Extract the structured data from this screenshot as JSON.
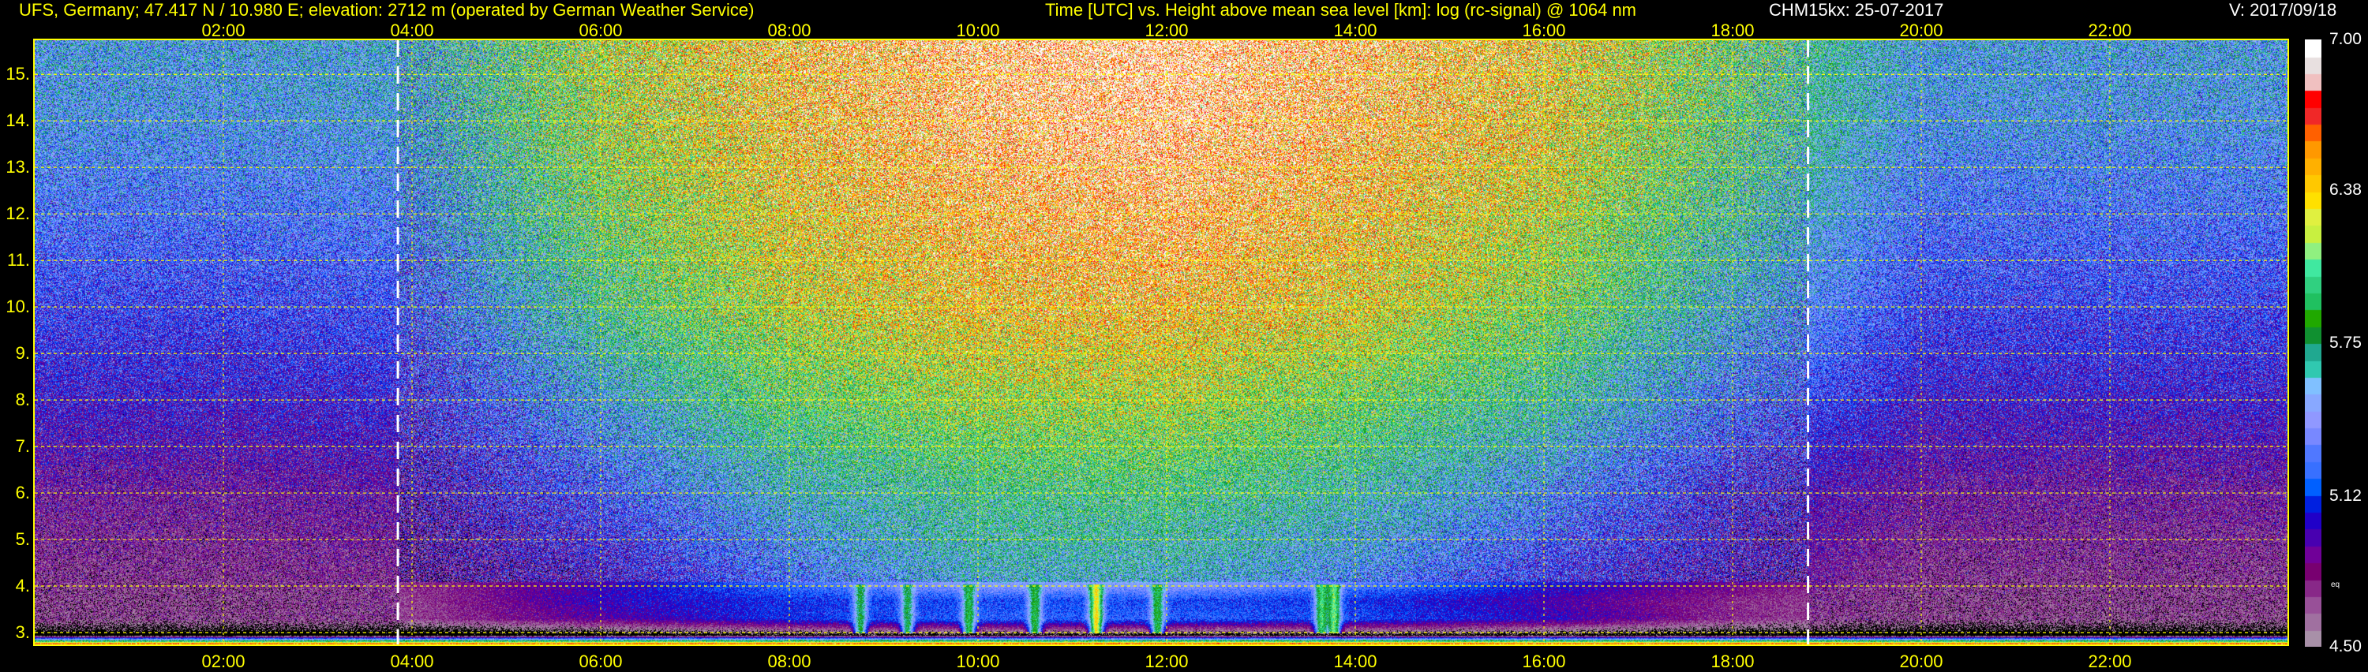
{
  "header": {
    "station": "UFS, Germany; 47.417 N / 10.980 E; elevation: 2712 m  (operated by German Weather Service)",
    "plot_title": "Time [UTC] vs. Height above mean sea level [km]: log (rc-signal) @ 1064 nm",
    "instrument": "CHM15kx: 25-07-2017",
    "version": "V: 2017/09/18"
  },
  "chart_data": {
    "type": "heatmap",
    "title": "Time [UTC] vs. Height above mean sea level [km]: log (rc-signal) @ 1064 nm",
    "xlabel": "Time [UTC]",
    "ylabel": "Height above mean sea level [km]",
    "xlim": [
      0,
      23.83
    ],
    "ylim": [
      2.712,
      15.75
    ],
    "x_ticks": [
      2,
      4,
      6,
      8,
      10,
      12,
      14,
      16,
      18,
      20,
      22
    ],
    "x_tick_labels": [
      "02:00",
      "04:00",
      "06:00",
      "08:00",
      "10:00",
      "12:00",
      "14:00",
      "16:00",
      "18:00",
      "20:00",
      "22:00"
    ],
    "y_ticks": [
      3,
      4,
      5,
      6,
      7,
      8,
      9,
      10,
      11,
      12,
      13,
      14,
      15
    ],
    "y_tick_labels": [
      "3.",
      "4.",
      "5.",
      "6.",
      "7.",
      "8.",
      "9.",
      "10.",
      "11.",
      "12.",
      "13.",
      "14.",
      "15."
    ],
    "grid": true,
    "dashed_markers_h": [
      3.85,
      18.8
    ],
    "colorbar": {
      "range": [
        4.5,
        7.0
      ],
      "tick_labels": [
        "7.00",
        "6.38",
        "5.75",
        "5.12",
        "4.50"
      ],
      "tick_values": [
        7.0,
        6.38,
        5.75,
        5.12,
        4.5
      ],
      "note": "eq",
      "colors_low_to_high": [
        "#a890a8",
        "#a070a0",
        "#985098",
        "#882888",
        "#780070",
        "#700098",
        "#4800b0",
        "#2000c8",
        "#0020e0",
        "#0060ff",
        "#3870ff",
        "#5078ff",
        "#7888ff",
        "#9098ff",
        "#88a8ff",
        "#80c0ff",
        "#30c8b0",
        "#20a890",
        "#109030",
        "#20a800",
        "#20c060",
        "#30d080",
        "#40e8a0",
        "#90f080",
        "#c8f040",
        "#e0f040",
        "#ffe000",
        "#ffc800",
        "#ffb000",
        "#ff9800",
        "#ff6000",
        "#f02828",
        "#ff0000",
        "#f0c0c0",
        "#e8e0e0",
        "#ffffff"
      ]
    },
    "grid_times_h": [
      0,
      2,
      4,
      6,
      8,
      10,
      12,
      14,
      16,
      18,
      20,
      22,
      24
    ],
    "grid_heights_km": [
      2.75,
      2.95,
      3.3,
      3.7,
      4.2,
      6,
      8,
      10,
      12,
      14,
      15.75
    ],
    "mean_log_signal": [
      [
        6.85,
        6.85,
        6.85,
        6.85,
        6.85,
        6.85,
        6.85,
        6.85,
        6.85,
        6.85,
        6.85,
        6.85,
        6.85
      ],
      [
        4.3,
        4.3,
        4.3,
        4.35,
        4.4,
        4.4,
        4.4,
        4.4,
        4.4,
        4.35,
        4.3,
        4.3,
        4.3
      ],
      [
        4.65,
        4.65,
        4.7,
        4.9,
        5.1,
        5.2,
        5.2,
        5.15,
        5.0,
        4.75,
        4.65,
        4.65,
        4.65
      ],
      [
        4.65,
        4.65,
        4.7,
        5.0,
        5.1,
        5.15,
        5.15,
        5.1,
        4.95,
        4.75,
        4.65,
        4.65,
        4.65
      ],
      [
        4.7,
        4.7,
        4.75,
        4.95,
        5.3,
        5.6,
        5.6,
        5.4,
        5.1,
        4.9,
        4.7,
        4.7,
        4.7
      ],
      [
        4.8,
        4.8,
        4.85,
        5.2,
        5.6,
        5.8,
        5.85,
        5.7,
        5.4,
        5.0,
        4.8,
        4.8,
        4.8
      ],
      [
        5.0,
        5.0,
        5.05,
        5.5,
        5.95,
        6.15,
        6.2,
        6.0,
        5.75,
        5.3,
        5.0,
        5.0,
        5.0
      ],
      [
        5.15,
        5.15,
        5.2,
        5.8,
        6.25,
        6.45,
        6.5,
        6.35,
        6.05,
        5.55,
        5.15,
        5.15,
        5.15
      ],
      [
        5.3,
        5.3,
        5.35,
        6.0,
        6.4,
        6.6,
        6.7,
        6.5,
        6.25,
        5.75,
        5.3,
        5.3,
        5.3
      ],
      [
        5.45,
        5.45,
        5.5,
        6.15,
        6.5,
        6.75,
        6.85,
        6.65,
        6.4,
        5.9,
        5.45,
        5.45,
        5.45
      ],
      [
        5.5,
        5.5,
        5.55,
        6.2,
        6.55,
        6.8,
        6.9,
        6.7,
        6.45,
        5.95,
        5.5,
        5.5,
        5.5
      ]
    ],
    "boundary_layer_plumes": [
      {
        "t": 8.75,
        "peak": 5.8
      },
      {
        "t": 9.25,
        "peak": 5.8
      },
      {
        "t": 9.9,
        "peak": 5.9
      },
      {
        "t": 10.6,
        "peak": 5.9
      },
      {
        "t": 11.25,
        "peak": 6.35
      },
      {
        "t": 11.9,
        "peak": 5.9
      },
      {
        "t": 13.64,
        "peak": 6.0
      },
      {
        "t": 13.77,
        "peak": 6.1
      }
    ]
  }
}
